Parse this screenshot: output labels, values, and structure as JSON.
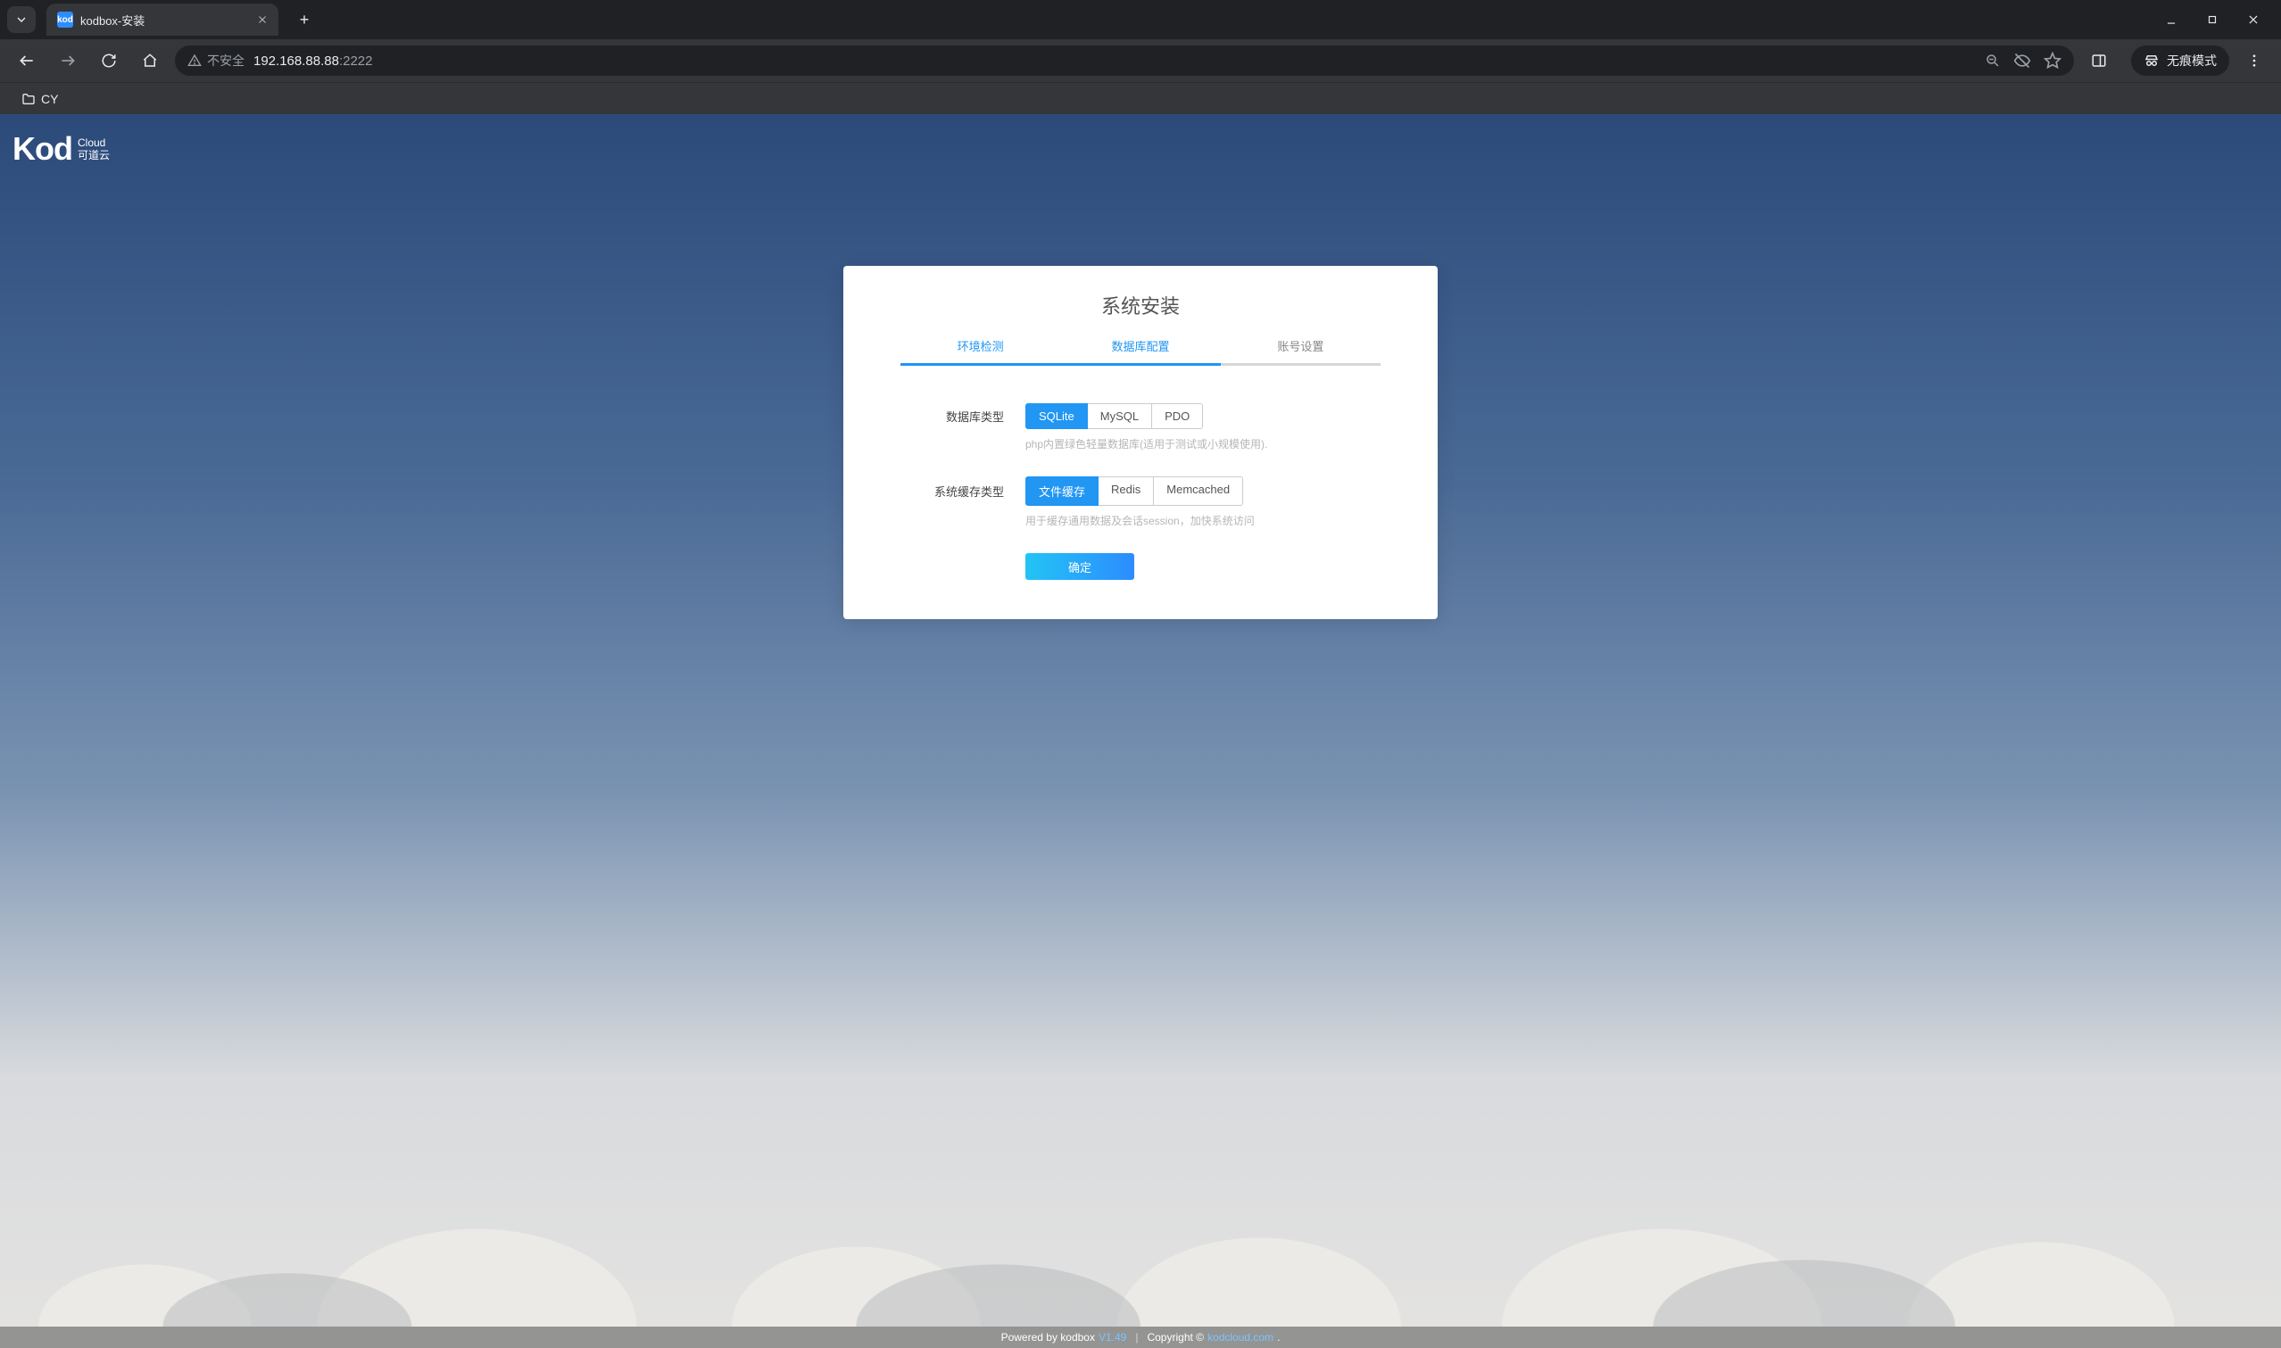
{
  "browser": {
    "tab": {
      "favicon_text": "kod",
      "title": "kodbox-安装"
    },
    "omnibox": {
      "warning_label": "不安全",
      "url_host_port": "192.168.88.88",
      "url_suffix": ":2222"
    },
    "incognito_label": "无痕模式",
    "bookmarks": [
      {
        "label": "CY"
      }
    ]
  },
  "logo": {
    "main": "Kod",
    "sub1": "Cloud",
    "sub2": "可道云"
  },
  "card": {
    "title": "系统安装",
    "steps": [
      {
        "label": "环境检测",
        "state": "done"
      },
      {
        "label": "数据库配置",
        "state": "active"
      },
      {
        "label": "账号设置",
        "state": "pending"
      }
    ],
    "db": {
      "label": "数据库类型",
      "options": [
        "SQLite",
        "MySQL",
        "PDO"
      ],
      "selected": "SQLite",
      "hint": "php内置绿色轻量数据库(适用于测试或小规模使用)."
    },
    "cache": {
      "label": "系统缓存类型",
      "options": [
        "文件缓存",
        "Redis",
        "Memcached"
      ],
      "selected": "文件缓存",
      "hint": "用于缓存通用数据及会话session，加快系统访问"
    },
    "submit": "确定"
  },
  "footer": {
    "powered": "Powered by kodbox",
    "version": "V1.49",
    "copyright": "Copyright ©",
    "link": "kodcloud.com",
    "tail": "."
  }
}
